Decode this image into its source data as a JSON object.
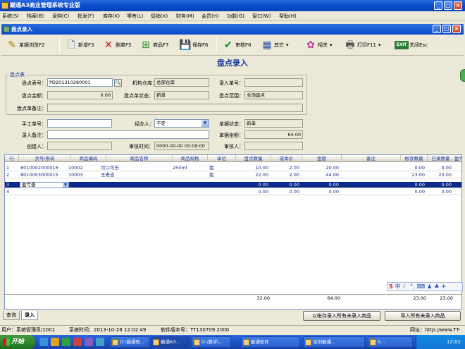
{
  "app": {
    "title": "巅通A3商业管理系统专业版",
    "menus": [
      "系统(S)",
      "档案(B)",
      "采购(C)",
      "批发(F)",
      "库存(K)",
      "零售(L)",
      "促销(X)",
      "财务(M)",
      "会员(H)",
      "功能(G)",
      "窗口(W)",
      "帮助(H)"
    ]
  },
  "window": {
    "title": "盘点录入"
  },
  "toolbar": {
    "browse": "单据浏览F2",
    "new": "新增F3",
    "delete": "删单F5",
    "product": "商品F7",
    "save": "保存F6",
    "audit": "审核F8",
    "other": "其它",
    "related": "相关",
    "print": "打印F11",
    "exit": "关闭Esc"
  },
  "form": {
    "title": "盘点录入",
    "group_label": "盘点表",
    "check_no_label": "盘点表号：",
    "check_no": "PD201310280001",
    "warehouse_label": "机构仓库：",
    "warehouse": "总部仓库",
    "entry_no_label": "录入单号：",
    "entry_no": "",
    "amount_label": "盘点金额：",
    "amount": "0.00",
    "status_label": "盘点单状态：",
    "status": "新单",
    "range_label": "盘点范围：",
    "range": "全场盘点",
    "remark_label": "盘点单备注：",
    "remark": "",
    "manual_no_label": "手工单号：",
    "manual_no": "",
    "handler_label": "经办人：",
    "handler": "不定",
    "doc_status_label": "单据状态：",
    "doc_status": "新单",
    "entry_remark_label": "录入备注：",
    "entry_remark": "",
    "doc_amount_label": "单据金额：",
    "doc_amount": "64.00",
    "creator_label": "创建人：",
    "creator": "",
    "audit_time_label": "审核时间：",
    "audit_time": "0000-00-00 00:00:00",
    "auditor_label": "审核人：",
    "auditor": ""
  },
  "grid": {
    "columns": [
      "行",
      "货号/条码",
      "商品编码",
      "商品名称",
      "商品规格",
      "单位",
      "盘点数量",
      "成本价",
      "金额",
      "备注",
      "帐存数量",
      "已录数量",
      "盈亏"
    ],
    "rows": [
      {
        "line": "1",
        "barcode": "8010002000016",
        "code": "10002",
        "name": "可口可乐",
        "spec": "250ml",
        "unit": "瓶",
        "qty": "10.00",
        "cost": "2.00",
        "amount": "20.00",
        "remark": "",
        "book_qty": "0.00",
        "entered_qty": "0.00"
      },
      {
        "line": "2",
        "barcode": "8010003000015",
        "code": "10003",
        "name": "王老吉",
        "spec": "",
        "unit": "瓶",
        "qty": "22.00",
        "cost": "2.00",
        "amount": "44.00",
        "remark": "",
        "book_qty": "23.00",
        "entered_qty": "23.00"
      },
      {
        "line": "3",
        "barcode": "",
        "code": "",
        "name": "",
        "spec": "",
        "unit": "",
        "qty": "0.00",
        "cost": "0.00",
        "amount": "0.00",
        "remark": "",
        "book_qty": "0.00",
        "entered_qty": "0.00"
      },
      {
        "line": "4",
        "barcode": "",
        "code": "",
        "name": "",
        "spec": "",
        "unit": "",
        "qty": "0.00",
        "cost": "0.00",
        "amount": "0.00",
        "remark": "",
        "book_qty": "0.00",
        "entered_qty": "0.00"
      }
    ],
    "edit_value": "盈亏查",
    "total_qty": "32.00",
    "total_amount": "64.00",
    "total_book": "23.00",
    "total_entered": "23.00"
  },
  "tabs": [
    "查询",
    "录入"
  ],
  "actions": {
    "book_unentered": "以帐存录入所有未录入商品",
    "import_unentered": "导入所有未录入商品"
  },
  "status": {
    "user": "用户：系统管理员/1001",
    "time": "系统时间：2013-10-28 12:02:49",
    "version": "软件版本号：TT130709.2000",
    "site": "网址：http://www.TT-"
  },
  "taskbar": {
    "start": "开始",
    "items": [
      "D:\\巅通软...",
      "巅通A3...",
      "D:\\教学\\...",
      "巅通软件",
      "深圳巅通...",
      "S..."
    ],
    "clock": "12:02"
  },
  "ime": "中"
}
